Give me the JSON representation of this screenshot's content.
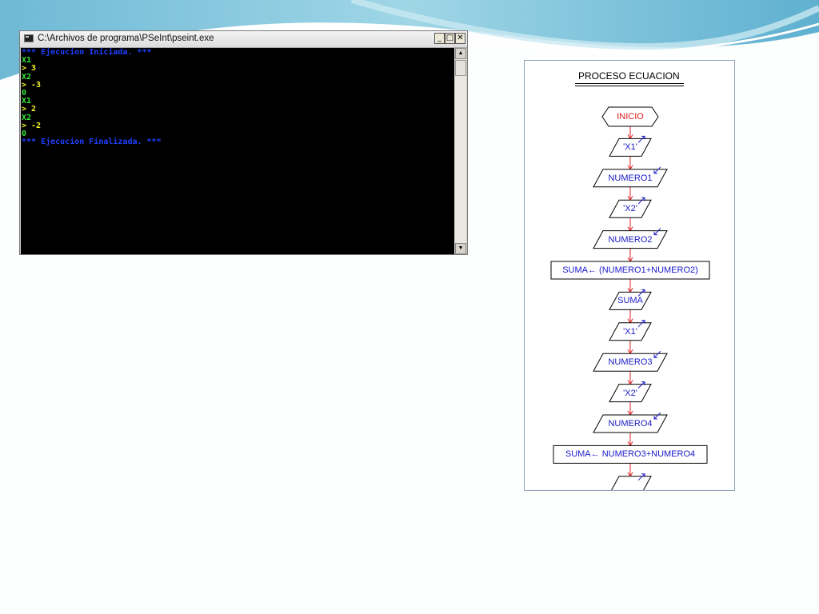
{
  "console": {
    "title": "C:\\Archivos de programa\\PSeInt\\pseint.exe",
    "buttons": {
      "minimize": "_",
      "maximize": "□",
      "close": "✕"
    },
    "scroll_up": "▲",
    "scroll_down": "▼",
    "lines": [
      {
        "text": "*** Ejecucion Iniciada. ***",
        "color": "#1f3fff"
      },
      {
        "text": "X1",
        "color": "#35e83c"
      },
      {
        "text": "> 3",
        "color": "#f6f62a"
      },
      {
        "text": "X2",
        "color": "#35e83c"
      },
      {
        "text": "> -3",
        "color": "#f6f62a"
      },
      {
        "text": "0",
        "color": "#35e83c"
      },
      {
        "text": "X1",
        "color": "#35e83c"
      },
      {
        "text": "> 2",
        "color": "#f6f62a"
      },
      {
        "text": "X2",
        "color": "#35e83c"
      },
      {
        "text": "> -2",
        "color": "#f6f62a"
      },
      {
        "text": "0",
        "color": "#35e83c"
      },
      {
        "text": "*** Ejecucion Finalizada. ***",
        "color": "#1f3fff"
      }
    ]
  },
  "flowchart": {
    "title": "PROCESO ECUACION",
    "nodes": [
      {
        "type": "start",
        "text": "INICIO"
      },
      {
        "type": "output",
        "text": "'X1'"
      },
      {
        "type": "input",
        "text": "NUMERO1"
      },
      {
        "type": "output",
        "text": "'X2'"
      },
      {
        "type": "input",
        "text": "NUMERO2"
      },
      {
        "type": "process",
        "text": "SUMA← (NUMERO1+NUMERO2)"
      },
      {
        "type": "output",
        "text": "SUMA"
      },
      {
        "type": "output",
        "text": "'X1'"
      },
      {
        "type": "input",
        "text": "NUMERO3"
      },
      {
        "type": "output",
        "text": "'X2'"
      },
      {
        "type": "input",
        "text": "NUMERO4"
      },
      {
        "type": "process",
        "text": "SUMA← NUMERO3+NUMERO4"
      },
      {
        "type": "output",
        "text": ""
      }
    ]
  },
  "colors": {
    "console_bg": "#000000",
    "flow_text": "#1a1ac8",
    "start_text": "#e01818",
    "connector": "#e02020"
  }
}
